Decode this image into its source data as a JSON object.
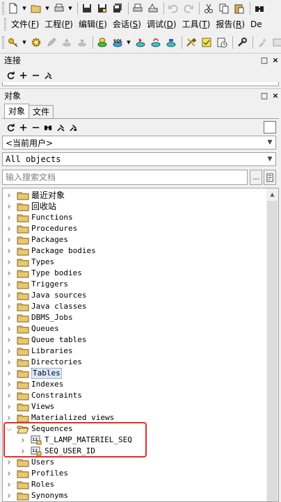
{
  "menu": [
    {
      "label": "文件",
      "key": "F"
    },
    {
      "label": "工程",
      "key": "P"
    },
    {
      "label": "编辑",
      "key": "E"
    },
    {
      "label": "会话",
      "key": "S"
    },
    {
      "label": "调试",
      "key": "D"
    },
    {
      "label": "工具",
      "key": "T"
    },
    {
      "label": "报告",
      "key": "R"
    },
    {
      "label": "De",
      "key": ""
    }
  ],
  "panels": {
    "connection": {
      "title": "连接",
      "controls": [
        "□",
        "×"
      ]
    },
    "objects": {
      "title": "对象",
      "controls": [
        "□",
        "×"
      ]
    }
  },
  "tabs": [
    {
      "label": "对象",
      "active": true
    },
    {
      "label": "文件",
      "active": false
    }
  ],
  "user_combo": {
    "value": "<当前用户>"
  },
  "filter_combo": {
    "value": "All objects"
  },
  "search": {
    "placeholder": "输入搜索文档",
    "button_label": "..."
  },
  "tree": {
    "items": [
      {
        "label": "最近对象",
        "cn": true
      },
      {
        "label": "回收站",
        "cn": true
      },
      {
        "label": "Functions"
      },
      {
        "label": "Procedures"
      },
      {
        "label": "Packages"
      },
      {
        "label": "Package bodies"
      },
      {
        "label": "Types"
      },
      {
        "label": "Type bodies"
      },
      {
        "label": "Triggers"
      },
      {
        "label": "Java sources"
      },
      {
        "label": "Java classes"
      },
      {
        "label": "DBMS_Jobs"
      },
      {
        "label": "Queues"
      },
      {
        "label": "Queue tables"
      },
      {
        "label": "Libraries"
      },
      {
        "label": "Directories"
      },
      {
        "label": "Tables",
        "selected": true
      },
      {
        "label": "Indexes"
      },
      {
        "label": "Constraints"
      },
      {
        "label": "Views"
      },
      {
        "label": "Materialized views"
      },
      {
        "label": "Sequences",
        "expanded": true
      },
      {
        "label": "T_LAMP_MATERIEL_SEQ",
        "child": true
      },
      {
        "label": "SEQ_USER_ID",
        "child": true
      },
      {
        "label": "Users"
      },
      {
        "label": "Profiles"
      },
      {
        "label": "Roles"
      },
      {
        "label": "Synonyms"
      }
    ]
  },
  "colors": {
    "highlight": "#e52a2a",
    "folder": "#e8c870",
    "selection": "#d9e8fb"
  }
}
